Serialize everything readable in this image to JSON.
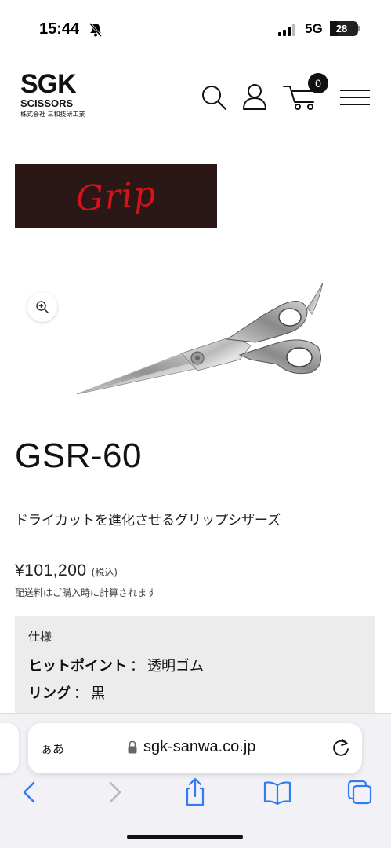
{
  "status_bar": {
    "time": "15:44",
    "network": "5G",
    "battery": "28",
    "battery_level": 0.28
  },
  "header": {
    "logo_main": "SGK",
    "logo_sub": "SCISSORS",
    "logo_company": "株式会社 三和技研工業",
    "cart_count": "0"
  },
  "banner": {
    "brand": "Grip"
  },
  "product": {
    "title": "GSR-60",
    "description": "ドライカットを進化させるグリップシザーズ",
    "price": "¥101,200",
    "tax_note": "(税込)",
    "shipping_note": "配送料はご購入時に計算されます"
  },
  "spec": {
    "heading": "仕様",
    "items": [
      {
        "label": "ヒットポイント",
        "sep": "：",
        "value": "透明ゴム"
      },
      {
        "label": "リング",
        "sep": "：",
        "value": "黒"
      }
    ]
  },
  "browser": {
    "reader_label": "ぁあ",
    "url": "sgk-sanwa.co.jp"
  },
  "icons": {
    "bell": "bell-slash-icon",
    "search": "search-icon",
    "account": "user-icon",
    "cart": "cart-icon",
    "menu": "hamburger-menu-icon",
    "zoom": "zoom-in-icon",
    "lock": "lock-icon",
    "reload": "reload-icon",
    "back": "chevron-left-icon",
    "forward": "chevron-right-icon",
    "share": "share-icon",
    "bookmarks": "book-icon",
    "tabs": "tabs-icon"
  },
  "colors": {
    "banner_bg": "#2b1716",
    "brand_red": "#d6121b",
    "ios_blue": "#2f7cf6",
    "spec_bg": "#ececec"
  }
}
